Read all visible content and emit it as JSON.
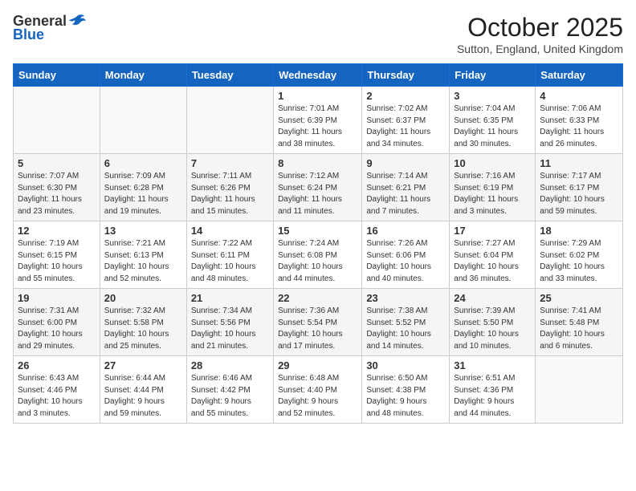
{
  "header": {
    "logo_general": "General",
    "logo_blue": "Blue",
    "month_title": "October 2025",
    "subtitle": "Sutton, England, United Kingdom"
  },
  "weekdays": [
    "Sunday",
    "Monday",
    "Tuesday",
    "Wednesday",
    "Thursday",
    "Friday",
    "Saturday"
  ],
  "weeks": [
    [
      {
        "day": "",
        "info": ""
      },
      {
        "day": "",
        "info": ""
      },
      {
        "day": "",
        "info": ""
      },
      {
        "day": "1",
        "info": "Sunrise: 7:01 AM\nSunset: 6:39 PM\nDaylight: 11 hours\nand 38 minutes."
      },
      {
        "day": "2",
        "info": "Sunrise: 7:02 AM\nSunset: 6:37 PM\nDaylight: 11 hours\nand 34 minutes."
      },
      {
        "day": "3",
        "info": "Sunrise: 7:04 AM\nSunset: 6:35 PM\nDaylight: 11 hours\nand 30 minutes."
      },
      {
        "day": "4",
        "info": "Sunrise: 7:06 AM\nSunset: 6:33 PM\nDaylight: 11 hours\nand 26 minutes."
      }
    ],
    [
      {
        "day": "5",
        "info": "Sunrise: 7:07 AM\nSunset: 6:30 PM\nDaylight: 11 hours\nand 23 minutes."
      },
      {
        "day": "6",
        "info": "Sunrise: 7:09 AM\nSunset: 6:28 PM\nDaylight: 11 hours\nand 19 minutes."
      },
      {
        "day": "7",
        "info": "Sunrise: 7:11 AM\nSunset: 6:26 PM\nDaylight: 11 hours\nand 15 minutes."
      },
      {
        "day": "8",
        "info": "Sunrise: 7:12 AM\nSunset: 6:24 PM\nDaylight: 11 hours\nand 11 minutes."
      },
      {
        "day": "9",
        "info": "Sunrise: 7:14 AM\nSunset: 6:21 PM\nDaylight: 11 hours\nand 7 minutes."
      },
      {
        "day": "10",
        "info": "Sunrise: 7:16 AM\nSunset: 6:19 PM\nDaylight: 11 hours\nand 3 minutes."
      },
      {
        "day": "11",
        "info": "Sunrise: 7:17 AM\nSunset: 6:17 PM\nDaylight: 10 hours\nand 59 minutes."
      }
    ],
    [
      {
        "day": "12",
        "info": "Sunrise: 7:19 AM\nSunset: 6:15 PM\nDaylight: 10 hours\nand 55 minutes."
      },
      {
        "day": "13",
        "info": "Sunrise: 7:21 AM\nSunset: 6:13 PM\nDaylight: 10 hours\nand 52 minutes."
      },
      {
        "day": "14",
        "info": "Sunrise: 7:22 AM\nSunset: 6:11 PM\nDaylight: 10 hours\nand 48 minutes."
      },
      {
        "day": "15",
        "info": "Sunrise: 7:24 AM\nSunset: 6:08 PM\nDaylight: 10 hours\nand 44 minutes."
      },
      {
        "day": "16",
        "info": "Sunrise: 7:26 AM\nSunset: 6:06 PM\nDaylight: 10 hours\nand 40 minutes."
      },
      {
        "day": "17",
        "info": "Sunrise: 7:27 AM\nSunset: 6:04 PM\nDaylight: 10 hours\nand 36 minutes."
      },
      {
        "day": "18",
        "info": "Sunrise: 7:29 AM\nSunset: 6:02 PM\nDaylight: 10 hours\nand 33 minutes."
      }
    ],
    [
      {
        "day": "19",
        "info": "Sunrise: 7:31 AM\nSunset: 6:00 PM\nDaylight: 10 hours\nand 29 minutes."
      },
      {
        "day": "20",
        "info": "Sunrise: 7:32 AM\nSunset: 5:58 PM\nDaylight: 10 hours\nand 25 minutes."
      },
      {
        "day": "21",
        "info": "Sunrise: 7:34 AM\nSunset: 5:56 PM\nDaylight: 10 hours\nand 21 minutes."
      },
      {
        "day": "22",
        "info": "Sunrise: 7:36 AM\nSunset: 5:54 PM\nDaylight: 10 hours\nand 17 minutes."
      },
      {
        "day": "23",
        "info": "Sunrise: 7:38 AM\nSunset: 5:52 PM\nDaylight: 10 hours\nand 14 minutes."
      },
      {
        "day": "24",
        "info": "Sunrise: 7:39 AM\nSunset: 5:50 PM\nDaylight: 10 hours\nand 10 minutes."
      },
      {
        "day": "25",
        "info": "Sunrise: 7:41 AM\nSunset: 5:48 PM\nDaylight: 10 hours\nand 6 minutes."
      }
    ],
    [
      {
        "day": "26",
        "info": "Sunrise: 6:43 AM\nSunset: 4:46 PM\nDaylight: 10 hours\nand 3 minutes."
      },
      {
        "day": "27",
        "info": "Sunrise: 6:44 AM\nSunset: 4:44 PM\nDaylight: 9 hours\nand 59 minutes."
      },
      {
        "day": "28",
        "info": "Sunrise: 6:46 AM\nSunset: 4:42 PM\nDaylight: 9 hours\nand 55 minutes."
      },
      {
        "day": "29",
        "info": "Sunrise: 6:48 AM\nSunset: 4:40 PM\nDaylight: 9 hours\nand 52 minutes."
      },
      {
        "day": "30",
        "info": "Sunrise: 6:50 AM\nSunset: 4:38 PM\nDaylight: 9 hours\nand 48 minutes."
      },
      {
        "day": "31",
        "info": "Sunrise: 6:51 AM\nSunset: 4:36 PM\nDaylight: 9 hours\nand 44 minutes."
      },
      {
        "day": "",
        "info": ""
      }
    ]
  ]
}
